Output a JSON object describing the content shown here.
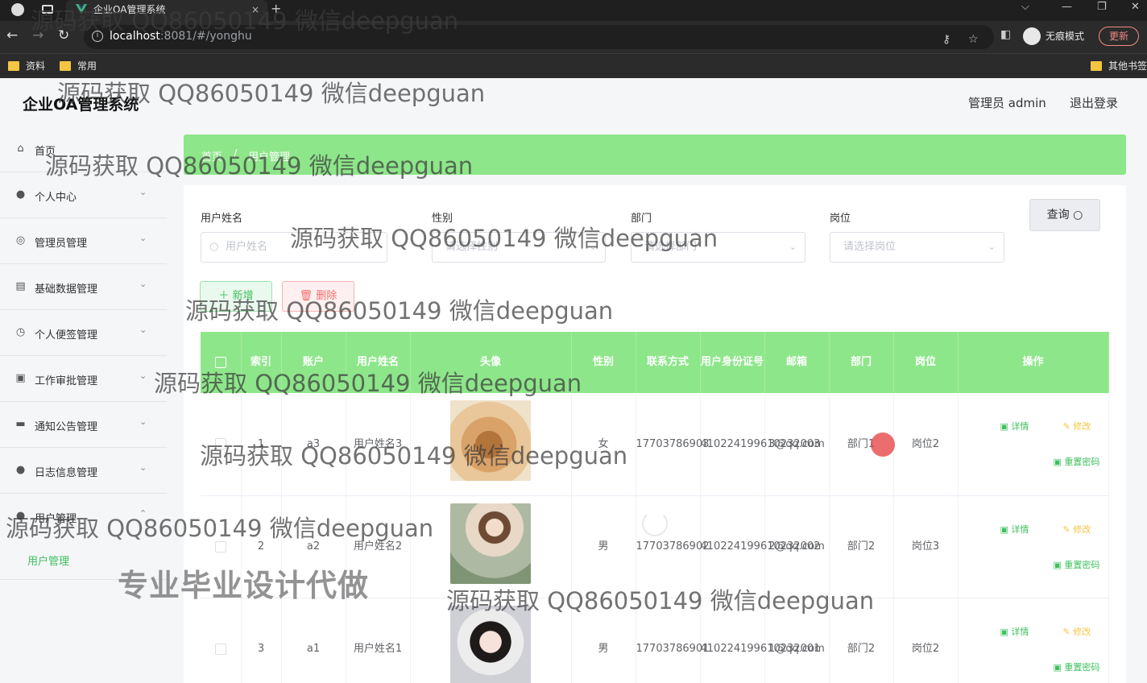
{
  "browser": {
    "tab_title": "企业OA管理系统",
    "url_host": "localhost",
    "url_rest": ":8081/#/yonghu",
    "incognito_label": "无痕模式",
    "update_label": "更新",
    "bookmarks": [
      "资料",
      "常用"
    ],
    "other_bookmarks": "其他书签"
  },
  "app": {
    "title": "企业OA管理系统",
    "user_label": "管理员 admin",
    "logout_label": "退出登录"
  },
  "sidebar": {
    "items": [
      {
        "label": "首页",
        "icon": "home-icon"
      },
      {
        "label": "个人中心",
        "icon": "user-icon"
      },
      {
        "label": "管理员管理",
        "icon": "admin-icon"
      },
      {
        "label": "基础数据管理",
        "icon": "database-icon"
      },
      {
        "label": "个人便签管理",
        "icon": "clock-icon"
      },
      {
        "label": "工作审批管理",
        "icon": "approval-icon"
      },
      {
        "label": "通知公告管理",
        "icon": "notice-icon"
      },
      {
        "label": "日志信息管理",
        "icon": "log-icon"
      },
      {
        "label": "用户管理",
        "icon": "users-icon"
      }
    ],
    "active_sub": "用户管理"
  },
  "breadcrumb": [
    "首页",
    "用户管理"
  ],
  "search": {
    "name_label": "用户姓名",
    "name_placeholder": "用户姓名",
    "gender_label": "性别",
    "gender_placeholder": "请选择性别",
    "dept_label": "部门",
    "dept_placeholder": "请选择部门",
    "post_label": "岗位",
    "post_placeholder": "请选择岗位",
    "query_label": "查询"
  },
  "actions": {
    "add_label": "新增",
    "delete_label": "删除"
  },
  "table": {
    "headers": {
      "index": "索引",
      "account": "账户",
      "name": "用户姓名",
      "avatar": "头像",
      "gender": "性别",
      "phone": "联系方式",
      "id_card": "用户身份证号",
      "email": "邮箱",
      "dept": "部门",
      "post": "岗位",
      "ops": "操作"
    },
    "ops": {
      "detail": "详情",
      "edit": "修改",
      "reset": "重置密码"
    },
    "rows": [
      {
        "index": "1",
        "account": "a3",
        "name": "用户姓名3",
        "gender": "女",
        "phone": "17703786903",
        "id_card": "410224199610232003",
        "email": "3@qq.com",
        "dept": "部门1",
        "post": "岗位2"
      },
      {
        "index": "2",
        "account": "a2",
        "name": "用户姓名2",
        "gender": "男",
        "phone": "17703786902",
        "id_card": "410224199610232002",
        "email": "2@qq.com",
        "dept": "部门2",
        "post": "岗位3"
      },
      {
        "index": "3",
        "account": "a1",
        "name": "用户姓名1",
        "gender": "男",
        "phone": "17703786901",
        "id_card": "410224199610232001",
        "email": "1@qq.com",
        "dept": "部门2",
        "post": "岗位2"
      }
    ]
  },
  "watermark": {
    "text": "源码获取 QQ86050149 微信deepguan",
    "banner": "专业毕业设计代做"
  }
}
